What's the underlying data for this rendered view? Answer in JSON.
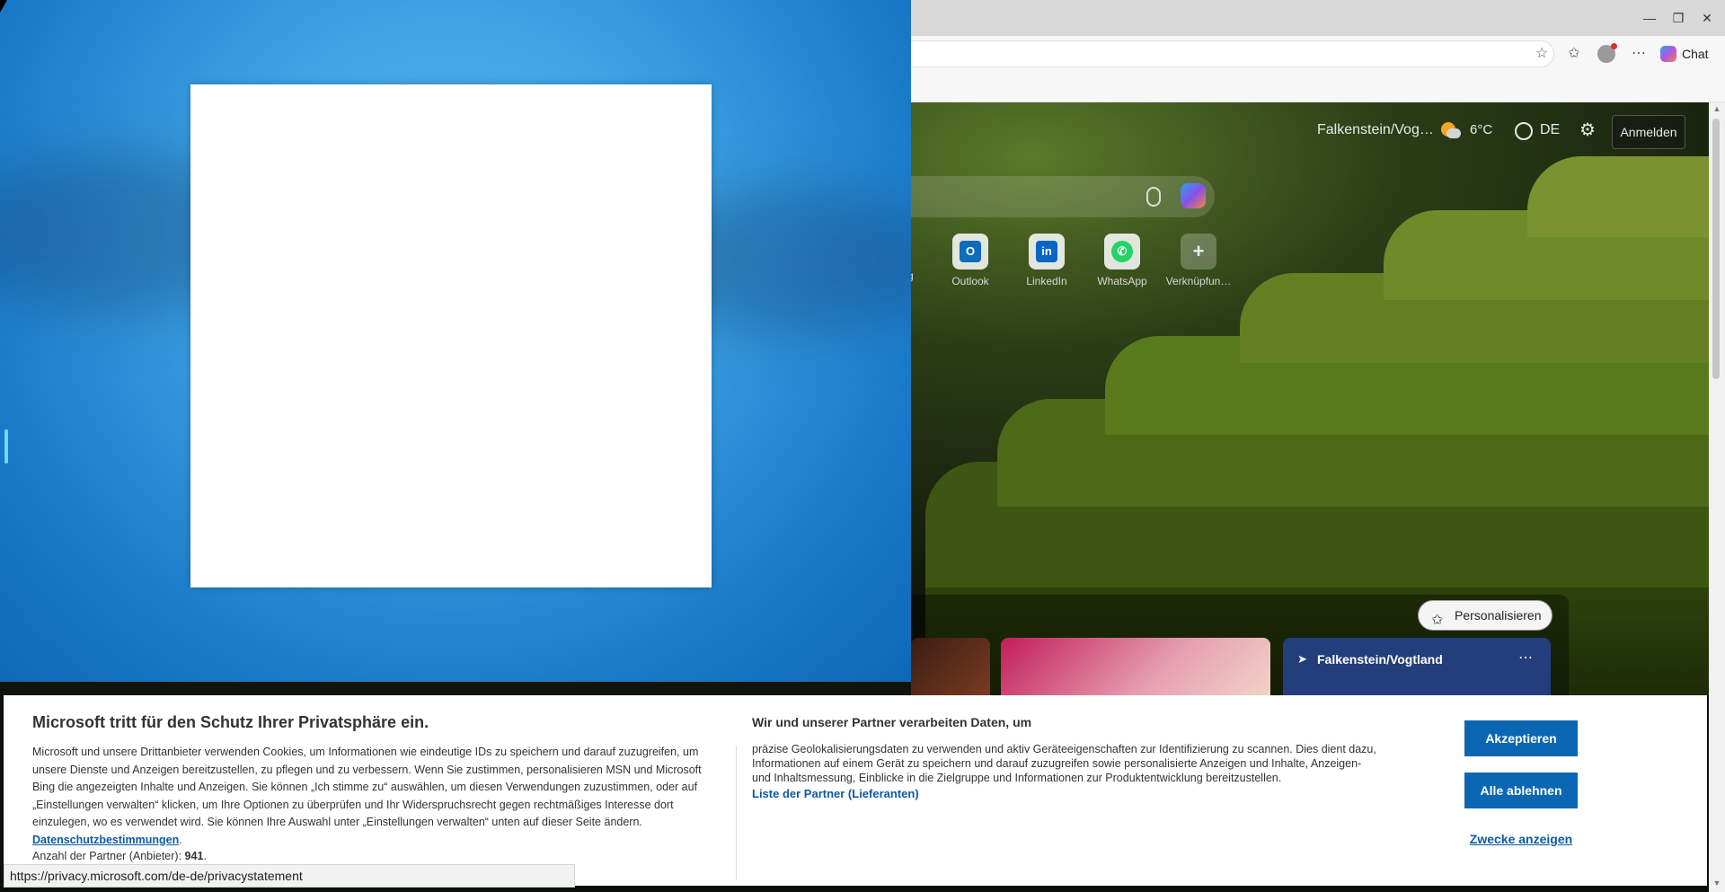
{
  "browser": {
    "window_controls": {
      "minimize": "—",
      "restore": "❐",
      "close": "✕"
    },
    "toolbar_icons": [
      "star-icon",
      "favorites-icon",
      "profile-icon",
      "more-icon"
    ],
    "chat_label": "Chat"
  },
  "msn": {
    "location": "Falkenstein/Vog…",
    "temperature": "6°C",
    "language": "DE",
    "signin_label": "Anmelden",
    "shortcuts": [
      {
        "label": "Outlook",
        "icon": "outlook-icon",
        "color": "#0f6cbd",
        "glyph": "O"
      },
      {
        "label": "LinkedIn",
        "icon": "linkedin-icon",
        "color": "#0a66c2",
        "glyph": "in"
      },
      {
        "label": "WhatsApp",
        "icon": "whatsapp-icon",
        "color": "#25d366",
        "glyph": "✆"
      },
      {
        "label": "Verknüpfun…",
        "icon": "add-icon",
        "color": "#dddddd",
        "glyph": "+"
      }
    ],
    "partial_shortcut_label": "g",
    "personalize_label": "Personalisieren",
    "weather_card_location": "Falkenstein/Vogtland"
  },
  "consent": {
    "title": "Microsoft tritt für den Schutz Ihrer Privatsphäre ein.",
    "body": "Microsoft und unsere Drittanbieter verwenden Cookies, um Informationen wie eindeutige IDs zu speichern und darauf zuzugreifen, um unsere Dienste und Anzeigen bereitzustellen, zu pflegen und zu verbessern. Wenn Sie zustimmen, personalisieren MSN und Microsoft Bing die angezeigten Inhalte und Anzeigen. Sie können „Ich stimme zu“ auswählen, um diesen Verwendungen zuzustimmen, oder auf „Einstellungen verwalten“ klicken, um Ihre Optionen zu überprüfen und Ihr Widerspruchsrecht gegen rechtmäßiges Interesse dort einzulegen, wo es verwendet wird.  Sie können Ihre Auswahl unter „Einstellungen verwalten“ unten auf dieser Seite ändern.",
    "privacy_link": "Datenschutzbestimmungen",
    "partner_count_label": "Anzahl der Partner (Anbieter):",
    "partner_count": "941",
    "right_title": "Wir und unserer Partner verarbeiten Daten, um",
    "right_body": "präzise Geolokalisierungsdaten zu verwenden und aktiv Geräteeigenschaften zur Identifizierung zu scannen. Dies dient dazu, Informationen auf einem Gerät zu speichern und darauf zuzugreifen sowie personalisierte Anzeigen und Inhalte, Anzeigen- und Inhaltsmessung, Einblicke in die Zielgruppe und Informationen zur Produktentwicklung bereitzustellen.",
    "partner_list_link": "Liste der Partner (Lieferanten)",
    "accept_label": "Akzeptieren",
    "reject_label": "Alle ablehnen",
    "purposes_label": "Zwecke anzeigen"
  },
  "status_url": "https://privacy.microsoft.com/de-de/privacystatement"
}
